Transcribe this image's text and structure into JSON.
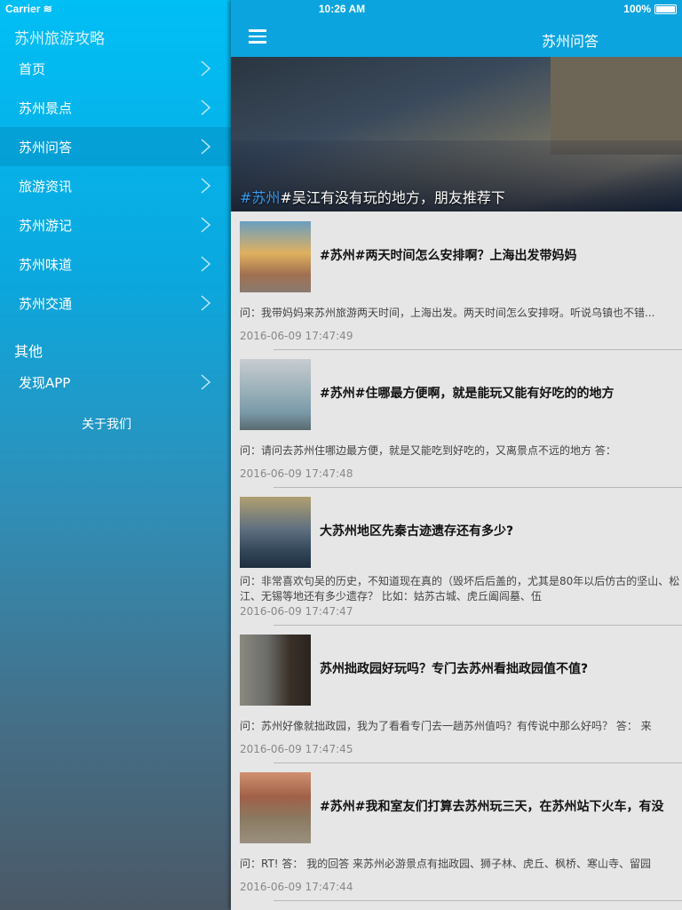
{
  "status": {
    "carrier": "Carrier",
    "time": "10:26 AM",
    "battery": "100%"
  },
  "sidebar": {
    "title": "苏州旅游攻略",
    "items": [
      {
        "label": "首页"
      },
      {
        "label": "苏州景点"
      },
      {
        "label": "苏州问答",
        "active": true
      },
      {
        "label": "旅游资讯"
      },
      {
        "label": "苏州游记"
      },
      {
        "label": "苏州味道"
      },
      {
        "label": "苏州交通"
      }
    ],
    "section": "其他",
    "other_items": [
      {
        "label": "发现APP"
      }
    ],
    "about": "关于我们"
  },
  "nav": {
    "title": "苏州问答"
  },
  "banner": {
    "tag": "#苏州",
    "caption": "#吴江有没有玩的地方，朋友推荐下"
  },
  "questions": [
    {
      "title": "#苏州#两天时间怎么安排啊？上海出发带妈妈",
      "desc": "问：我带妈妈来苏州旅游两天时间，上海出发。两天时间怎么安排呀。听说乌镇也不错...",
      "date": "2016-06-09 17:47:49"
    },
    {
      "title": "#苏州#住哪最方便啊，就是能玩又能有好吃的的地方",
      "desc": "问：请问去苏州住哪边最方便，就是又能吃到好吃的，又离景点不远的地方 答：",
      "date": "2016-06-09 17:47:48"
    },
    {
      "title": "大苏州地区先秦古迹遗存还有多少?",
      "desc": "问：非常喜欢句吴的历史，不知道现在真的（毁坏后后盖的，尤其是80年以后仿古的坚山、松江、无锡等地还有多少遗存？ 比如：姑苏古城、虎丘阖闾墓、伍",
      "date": "2016-06-09 17:47:47"
    },
    {
      "title": "苏州拙政园好玩吗？专门去苏州看拙政园值不值?",
      "desc": "问：苏州好像就拙政园，我为了看看专门去一趟苏州值吗？有传说中那么好吗？ 答： 来",
      "date": "2016-06-09 17:47:45"
    },
    {
      "title": "#苏州#我和室友们打算去苏州玩三天，在苏州站下火车，有没",
      "desc": "问：RT! 答： 我的回答 来苏州必游景点有拙政园、狮子林、虎丘、枫桥、寒山寺、留园",
      "date": "2016-06-09 17:47:44"
    }
  ]
}
